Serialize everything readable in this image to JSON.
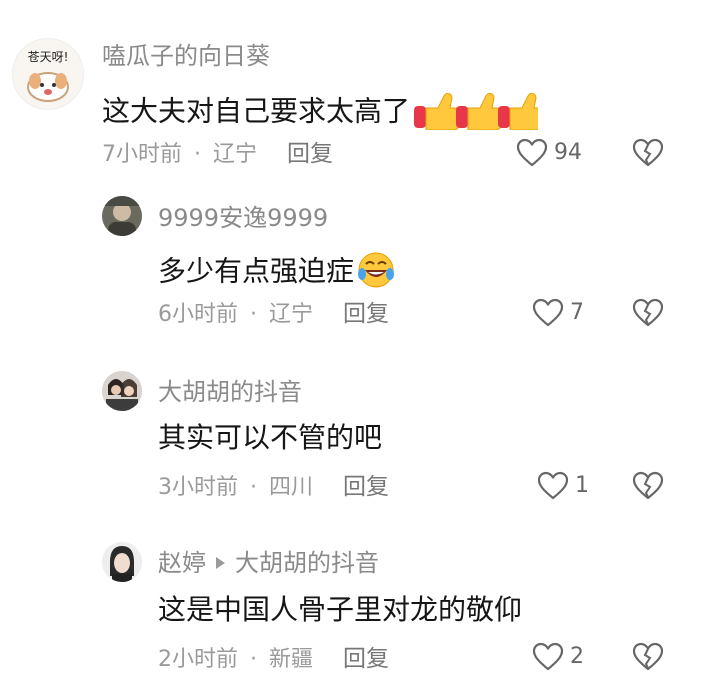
{
  "comments": [
    {
      "user": "嗑瓜子的向日葵",
      "avatar_text": "苍天呀!",
      "text": "这大夫对自己要求太高了",
      "emoji": "thumbs-up x3",
      "time": "7小时前",
      "location": "辽宁",
      "reply_label": "回复",
      "likes": "94"
    },
    {
      "user": "9999安逸9999",
      "text": "多少有点强迫症",
      "emoji": "laughing-tears",
      "time": "6小时前",
      "location": "辽宁",
      "reply_label": "回复",
      "likes": "7"
    },
    {
      "user": "大胡胡的抖音",
      "text": "其实可以不管的吧",
      "time": "3小时前",
      "location": "四川",
      "reply_label": "回复",
      "likes": "1"
    },
    {
      "user": "赵婷",
      "reply_to": "大胡胡的抖音",
      "text": "这是中国人骨子里对龙的敬仰",
      "time": "2小时前",
      "location": "新疆",
      "reply_label": "回复",
      "likes": "2"
    }
  ],
  "separator": "·",
  "icons": {
    "like": "heart-outline-icon",
    "dislike": "broken-heart-icon",
    "reply_arrow": "triangle-right-icon"
  },
  "colors": {
    "username": "#8a8a8a",
    "meta": "#9a9a9a",
    "text": "#161616",
    "thumbs": "#f6b400"
  }
}
